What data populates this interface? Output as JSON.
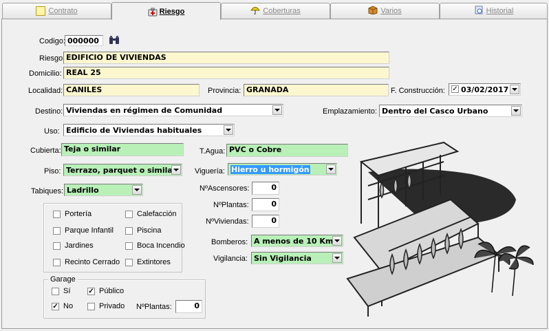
{
  "tabs": [
    {
      "label": "Contrato",
      "icon": "contract-icon"
    },
    {
      "label": "Riesgo",
      "icon": "first-aid-icon"
    },
    {
      "label": "Coberturas",
      "icon": "umbrella-icon"
    },
    {
      "label": "Varios",
      "icon": "box-icon"
    },
    {
      "label": "Historial",
      "icon": "history-icon"
    }
  ],
  "active_tab": "Riesgo",
  "form": {
    "codigo": {
      "label": "Codigo:",
      "value": "000000"
    },
    "riesgo": {
      "label": "Riesgo:",
      "value": "EDIFICIO DE VIVIENDAS"
    },
    "domicilio": {
      "label": "Domicilio:",
      "value": "REAL 25"
    },
    "localidad": {
      "label": "Localidad:",
      "value": "CANILES"
    },
    "provincia": {
      "label": "Provincia:",
      "value": "GRANADA"
    },
    "f_construccion": {
      "label": "F. Construcción:",
      "value": "03/02/2017",
      "checked": true
    },
    "destino": {
      "label": "Destino:",
      "value": "Viviendas en régimen de Comunidad"
    },
    "emplazamiento": {
      "label": "Emplazamiento:",
      "value": "Dentro del Casco Urbano"
    },
    "uso": {
      "label": "Uso:",
      "value": "Edificio de Viviendas habituales"
    },
    "cubierta": {
      "label": "Cubierta:",
      "value": "Teja o similar"
    },
    "t_agua": {
      "label": "T.Agua:",
      "value": "PVC o Cobre"
    },
    "piso": {
      "label": "Piso:",
      "value": "Terrazo, parquet o similar"
    },
    "vigueria": {
      "label": "Viguería:",
      "value": "Hierro u hormigón"
    },
    "tabiques": {
      "label": "Tabiques:",
      "value": "Ladrillo"
    },
    "n_ascensores": {
      "label": "NºAscensores:",
      "value": "0"
    },
    "n_plantas": {
      "label": "NºPlantas:",
      "value": "0"
    },
    "n_viviendas": {
      "label": "NºViviendas:",
      "value": "0"
    },
    "bomberos": {
      "label": "Bomberos:",
      "value": "A menos de 10 Km."
    },
    "vigilancia": {
      "label": "Vigilancia:",
      "value": "Sin Vigilancia"
    }
  },
  "features": [
    {
      "label": "Portería",
      "checked": false
    },
    {
      "label": "Calefacción",
      "checked": false
    },
    {
      "label": "Parque Infantil",
      "checked": false
    },
    {
      "label": "Piscina",
      "checked": false
    },
    {
      "label": "Jardines",
      "checked": false
    },
    {
      "label": "Boca Incendio",
      "checked": false
    },
    {
      "label": "Recinto Cerrado",
      "checked": false
    },
    {
      "label": "Extintores",
      "checked": false
    }
  ],
  "garage": {
    "title": "Garage",
    "si": {
      "label": "Sí",
      "checked": false
    },
    "no": {
      "label": "No",
      "checked": true
    },
    "publico": {
      "label": "Público",
      "checked": true
    },
    "privado": {
      "label": "Privado",
      "checked": false
    },
    "n_plantas": {
      "label": "NºPlantas:",
      "value": "0"
    }
  },
  "colors": {
    "required_field": "#fdf7d0",
    "optional_field": "#b8f0b8",
    "selection": "#3399ff"
  }
}
